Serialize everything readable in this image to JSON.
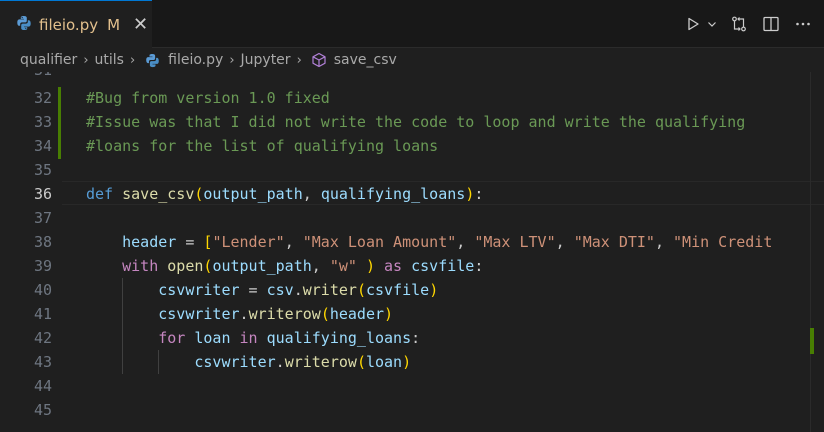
{
  "tab": {
    "filename": "fileio.py",
    "status": "M",
    "close_glyph": "✕"
  },
  "toolbar_icons": [
    "run-icon",
    "chevron-down-icon",
    "compare-changes-icon",
    "split-editor-icon",
    "more-actions-icon"
  ],
  "breadcrumb": {
    "items": [
      "qualifier",
      "utils",
      "fileio.py",
      "Jupyter",
      "save_csv"
    ]
  },
  "editor": {
    "active_line": "36",
    "partial_top_line": "31",
    "lines": [
      {
        "num": "32",
        "tokens": [
          {
            "t": "#Bug from version 1.0 fixed",
            "c": "com"
          }
        ]
      },
      {
        "num": "33",
        "tokens": [
          {
            "t": "#Issue was that I did not write the code to loop and write the qualifying",
            "c": "com"
          }
        ]
      },
      {
        "num": "34",
        "tokens": [
          {
            "t": "#loans for the list of qualifying loans",
            "c": "com"
          }
        ]
      },
      {
        "num": "35",
        "tokens": []
      },
      {
        "num": "36",
        "tokens": [
          {
            "t": "def",
            "c": "kw"
          },
          {
            "t": " ",
            "c": "txt"
          },
          {
            "t": "save_csv",
            "c": "fn"
          },
          {
            "t": "(",
            "c": "p1"
          },
          {
            "t": "output_path",
            "c": "var"
          },
          {
            "t": ", ",
            "c": "txt"
          },
          {
            "t": "qualifying_loans",
            "c": "var"
          },
          {
            "t": ")",
            "c": "p1"
          },
          {
            "t": ":",
            "c": "txt"
          }
        ]
      },
      {
        "num": "37",
        "tokens": []
      },
      {
        "num": "38",
        "tokens": [
          {
            "t": "    ",
            "c": "txt"
          },
          {
            "t": "header",
            "c": "var"
          },
          {
            "t": " = ",
            "c": "txt"
          },
          {
            "t": "[",
            "c": "p1"
          },
          {
            "t": "\"Lender\"",
            "c": "str"
          },
          {
            "t": ", ",
            "c": "txt"
          },
          {
            "t": "\"Max Loan Amount\"",
            "c": "str"
          },
          {
            "t": ", ",
            "c": "txt"
          },
          {
            "t": "\"Max LTV\"",
            "c": "str"
          },
          {
            "t": ", ",
            "c": "txt"
          },
          {
            "t": "\"Max DTI\"",
            "c": "str"
          },
          {
            "t": ", ",
            "c": "txt"
          },
          {
            "t": "\"Min Credit",
            "c": "str"
          }
        ]
      },
      {
        "num": "39",
        "tokens": [
          {
            "t": "    ",
            "c": "txt"
          },
          {
            "t": "with",
            "c": "ctrl"
          },
          {
            "t": " ",
            "c": "txt"
          },
          {
            "t": "open",
            "c": "fn"
          },
          {
            "t": "(",
            "c": "p1"
          },
          {
            "t": "output_path",
            "c": "var"
          },
          {
            "t": ", ",
            "c": "txt"
          },
          {
            "t": "\"w\"",
            "c": "str"
          },
          {
            "t": " ",
            "c": "txt"
          },
          {
            "t": ")",
            "c": "p1"
          },
          {
            "t": " ",
            "c": "txt"
          },
          {
            "t": "as",
            "c": "ctrl"
          },
          {
            "t": " ",
            "c": "txt"
          },
          {
            "t": "csvfile",
            "c": "var"
          },
          {
            "t": ":",
            "c": "txt"
          }
        ]
      },
      {
        "num": "40",
        "tokens": [
          {
            "t": "        ",
            "c": "txt"
          },
          {
            "t": "csvwriter",
            "c": "var"
          },
          {
            "t": " = ",
            "c": "txt"
          },
          {
            "t": "csv",
            "c": "var"
          },
          {
            "t": ".",
            "c": "txt"
          },
          {
            "t": "writer",
            "c": "fn"
          },
          {
            "t": "(",
            "c": "p1"
          },
          {
            "t": "csvfile",
            "c": "var"
          },
          {
            "t": ")",
            "c": "p1"
          }
        ]
      },
      {
        "num": "41",
        "tokens": [
          {
            "t": "        ",
            "c": "txt"
          },
          {
            "t": "csvwriter",
            "c": "var"
          },
          {
            "t": ".",
            "c": "txt"
          },
          {
            "t": "writerow",
            "c": "fn"
          },
          {
            "t": "(",
            "c": "p1"
          },
          {
            "t": "header",
            "c": "var"
          },
          {
            "t": ")",
            "c": "p1"
          }
        ]
      },
      {
        "num": "42",
        "tokens": [
          {
            "t": "        ",
            "c": "txt"
          },
          {
            "t": "for",
            "c": "ctrl"
          },
          {
            "t": " ",
            "c": "txt"
          },
          {
            "t": "loan",
            "c": "var"
          },
          {
            "t": " ",
            "c": "txt"
          },
          {
            "t": "in",
            "c": "ctrl"
          },
          {
            "t": " ",
            "c": "txt"
          },
          {
            "t": "qualifying_loans",
            "c": "var"
          },
          {
            "t": ":",
            "c": "txt"
          }
        ]
      },
      {
        "num": "43",
        "tokens": [
          {
            "t": "            ",
            "c": "txt"
          },
          {
            "t": "csvwriter",
            "c": "var"
          },
          {
            "t": ".",
            "c": "txt"
          },
          {
            "t": "writerow",
            "c": "fn"
          },
          {
            "t": "(",
            "c": "p1"
          },
          {
            "t": "loan",
            "c": "var"
          },
          {
            "t": ")",
            "c": "p1"
          }
        ]
      },
      {
        "num": "44",
        "tokens": []
      },
      {
        "num": "45",
        "tokens": []
      }
    ]
  }
}
